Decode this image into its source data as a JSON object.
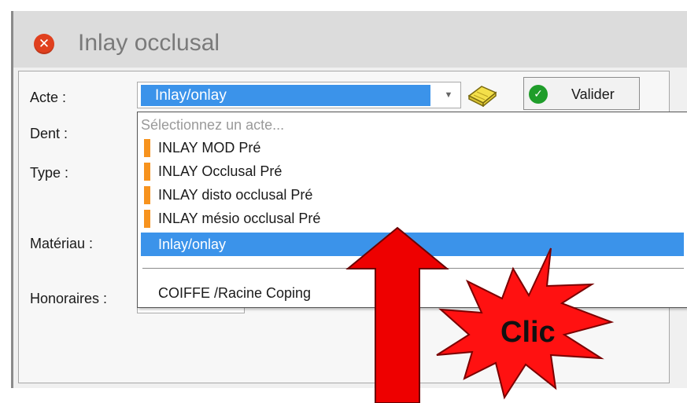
{
  "window": {
    "title": "Inlay occlusal",
    "close_icon": "close-x-icon"
  },
  "form": {
    "labels": {
      "acte": "Acte :",
      "dent": "Dent :",
      "type": "Type :",
      "materiau": "Matériau :",
      "honoraires": "Honoraires :"
    },
    "acte_value": "Inlay/onlay",
    "validate_label": "Valider",
    "book_icon": "book-icon",
    "check_icon": "check-icon"
  },
  "dropdown": {
    "placeholder": "Sélectionnez un acte...",
    "items": [
      {
        "label": "INLAY MOD Pré",
        "marker_color": "#f7931e"
      },
      {
        "label": "INLAY Occlusal Pré",
        "marker_color": "#f7931e"
      },
      {
        "label": "INLAY disto occlusal Pré",
        "marker_color": "#f7931e"
      },
      {
        "label": "INLAY mésio occlusal Pré",
        "marker_color": "#f7931e"
      },
      {
        "label": "Inlay/onlay",
        "selected": true
      },
      {
        "label": "COIFFE /Racine Coping"
      }
    ]
  },
  "annotation": {
    "text": "Clic",
    "arrow_color": "#ee0000",
    "star_color": "#ff1111"
  },
  "colors": {
    "selection": "#3b93ea",
    "marker": "#f7931e",
    "close_icon": "#e0401e",
    "check_icon": "#1f9d2a"
  }
}
